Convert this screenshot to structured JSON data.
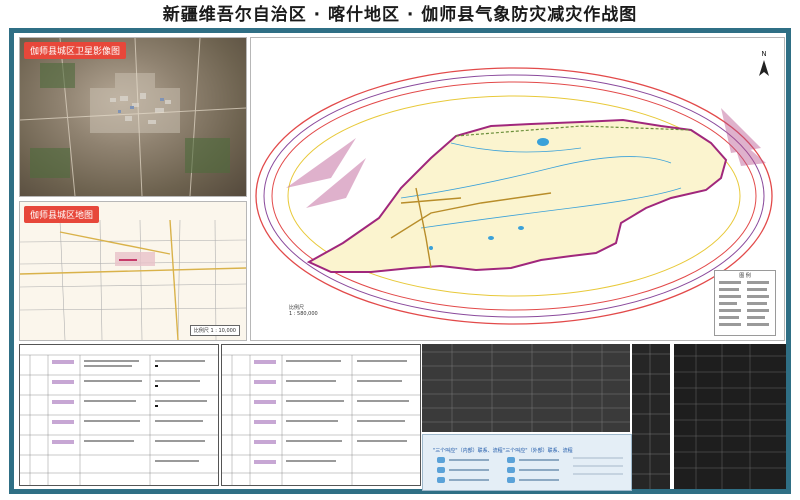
{
  "title": "新疆维吾尔自治区 · 喀什地区 · 伽师县气象防灾减灾作战图",
  "insets": {
    "satellite_label": "伽师县城区卫星影像图",
    "citymap_label": "伽师县城区地图",
    "citymap_scale": "比例尺 1 : 10,000"
  },
  "mainmap": {
    "north_label": "N",
    "legend_title": "图 例",
    "scale_label": "比例尺",
    "scale_value": "1 : 580,000"
  },
  "panel": {
    "caption_left": "\"三个叫应\"（内部）联系、流程",
    "caption_right": "\"三个叫应\"（外部）联系、流程"
  },
  "colors": {
    "frame": "#2f6f85",
    "tag": "#e7473a",
    "county_fill": "#fbf4cf",
    "county_border": "#a0277c",
    "ring_red": "#e24a4a",
    "ring_yellow": "#e8c93a",
    "ring_purple": "#8a4a9c",
    "river": "#3aa1d9",
    "road": "#b88d2a"
  }
}
